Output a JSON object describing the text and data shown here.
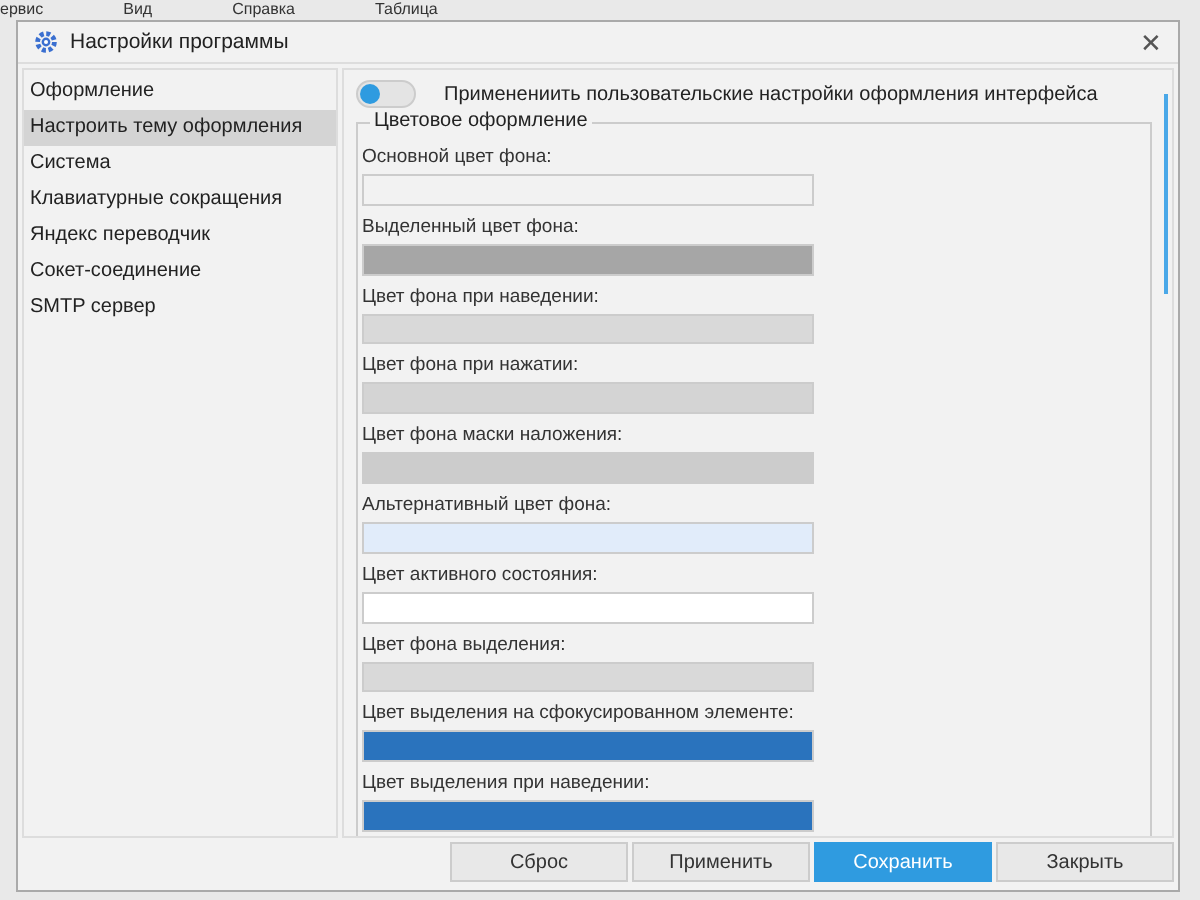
{
  "background_menu": [
    "ервис",
    "Вид",
    "Справка",
    "Таблица"
  ],
  "window": {
    "title": "Настройки программы",
    "close": "✕"
  },
  "sidebar": {
    "items": [
      {
        "label": "Оформление",
        "selected": false
      },
      {
        "label": "Настроить тему оформления",
        "selected": true
      },
      {
        "label": "Система",
        "selected": false
      },
      {
        "label": "Клавиатурные сокращения",
        "selected": false
      },
      {
        "label": "Яндекс переводчик",
        "selected": false
      },
      {
        "label": "Сокет-соединение",
        "selected": false
      },
      {
        "label": "SMTP сервер",
        "selected": false
      }
    ]
  },
  "custom_theme": {
    "label": "Применениить пользовательские настройки оформления интерфейса",
    "on": false
  },
  "color_group": {
    "title": "Цветовое оформление",
    "fields": [
      {
        "label": "Основной цвет фона:",
        "color": "#f2f2f2"
      },
      {
        "label": "Выделенный цвет фона:",
        "color": "#a6a6a6"
      },
      {
        "label": "Цвет фона при наведении:",
        "color": "#d9d9d9"
      },
      {
        "label": "Цвет фона при нажатии:",
        "color": "#d4d4d4"
      },
      {
        "label": "Цвет фона маски наложения:",
        "color": "#cccccc"
      },
      {
        "label": "Альтернативный цвет фона:",
        "color": "#e1ecfa"
      },
      {
        "label": "Цвет активного состояния:",
        "color": "#ffffff"
      },
      {
        "label": "Цвет фона выделения:",
        "color": "#d9d9d9"
      },
      {
        "label": "Цвет выделения на сфокусированном элементе:",
        "color": "#2a73bd"
      },
      {
        "label": "Цвет выделения при наведении:",
        "color": "#2a73bd"
      }
    ]
  },
  "buttons": [
    {
      "label": "Сброс",
      "kind": "normal"
    },
    {
      "label": "Применить",
      "kind": "normal"
    },
    {
      "label": "Сохранить",
      "kind": "primary"
    },
    {
      "label": "Закрыть",
      "kind": "normal"
    }
  ]
}
